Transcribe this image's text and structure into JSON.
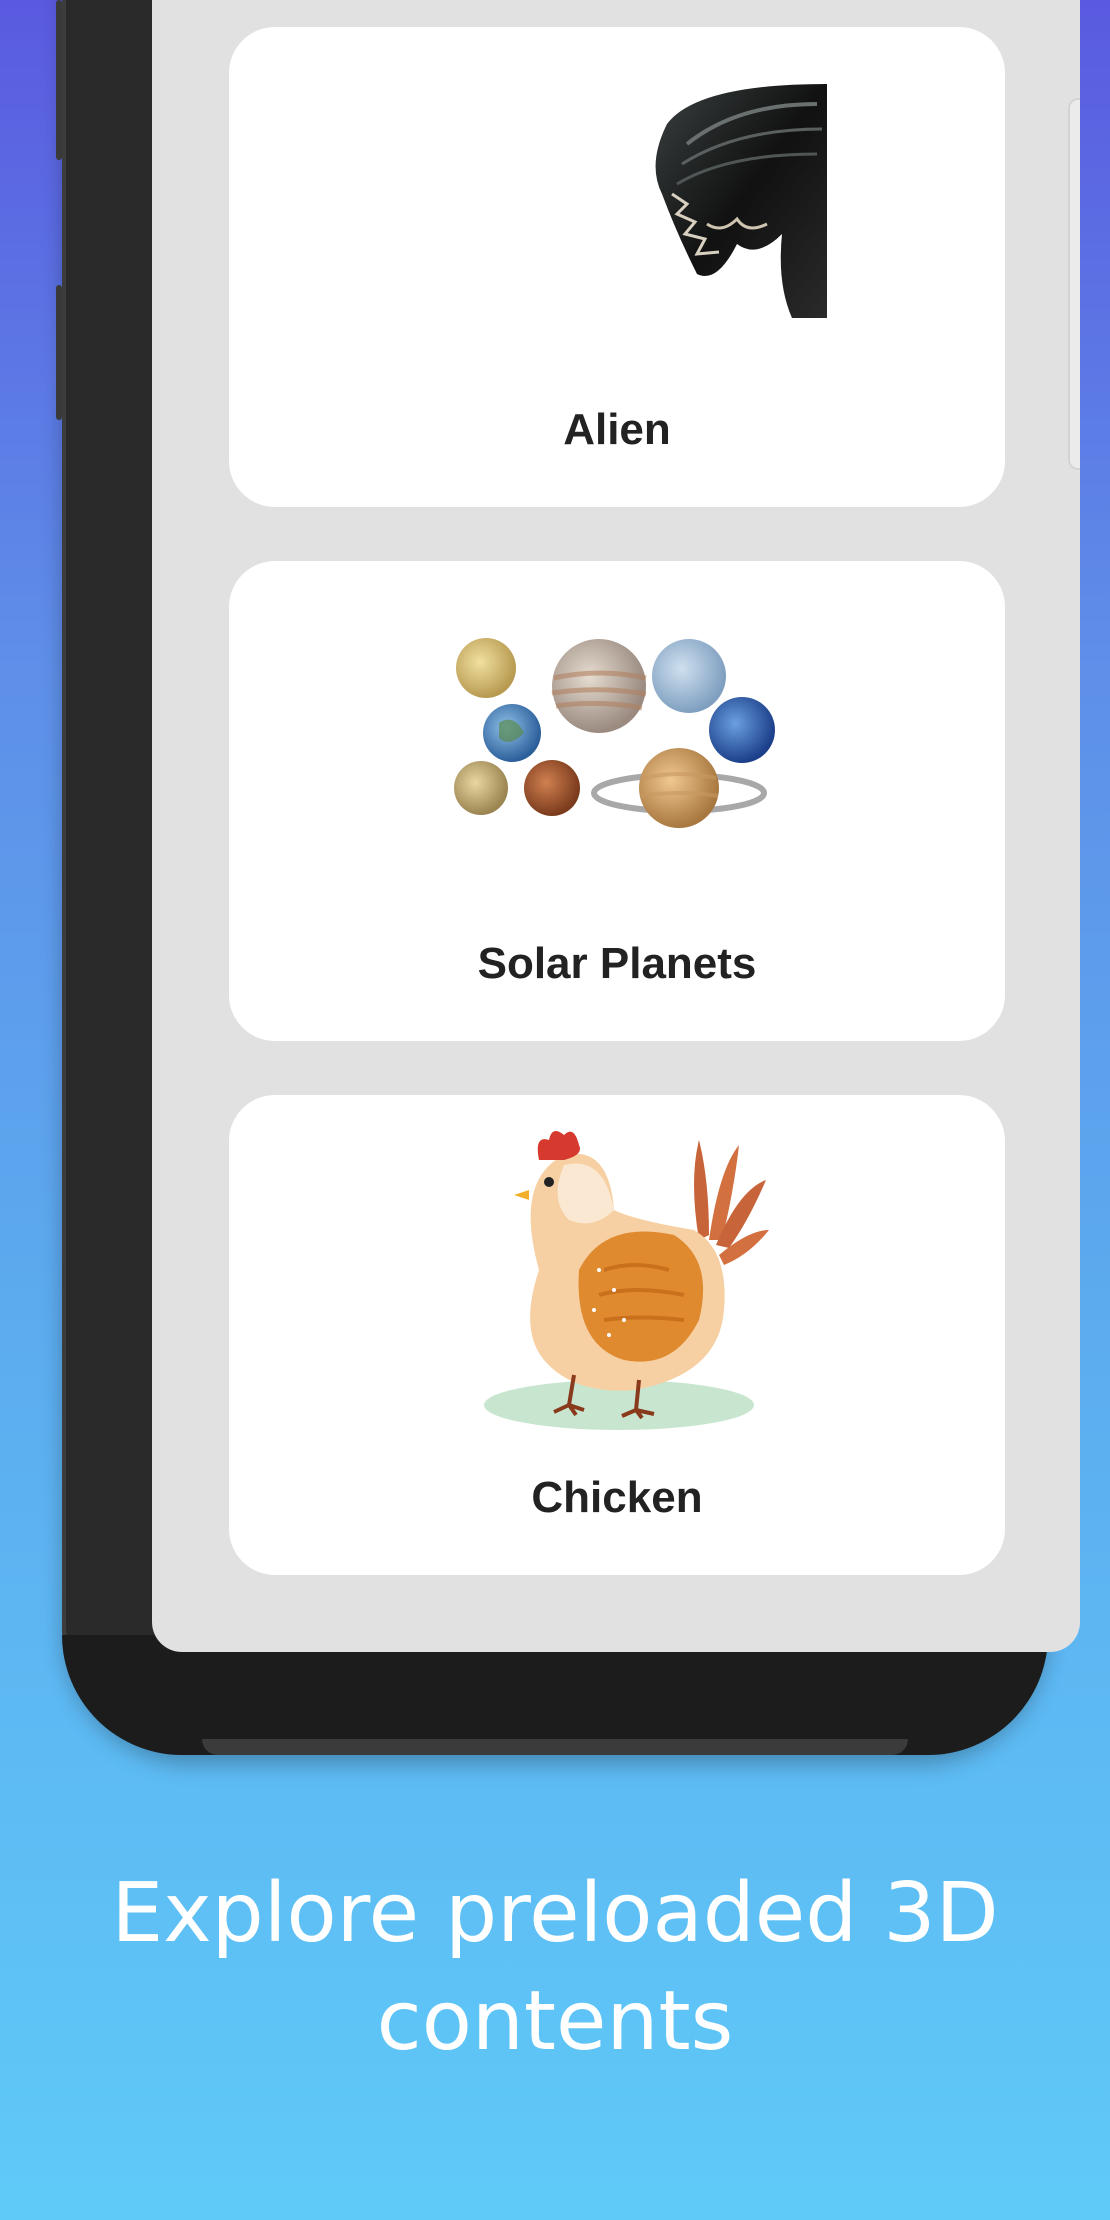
{
  "cards": [
    {
      "title": "Alien",
      "icon": "alien-thumbnail"
    },
    {
      "title": "Solar Planets",
      "icon": "planets-thumbnail"
    },
    {
      "title": "Chicken",
      "icon": "chicken-thumbnail"
    }
  ],
  "caption": {
    "line1": "Explore preloaded 3D",
    "line2": "contents"
  },
  "colors": {
    "background_top": "#5a5ae0",
    "background_bottom": "#5fcaf8",
    "screen": "#e1e1e1",
    "card": "#ffffff",
    "title_text": "#222222"
  }
}
